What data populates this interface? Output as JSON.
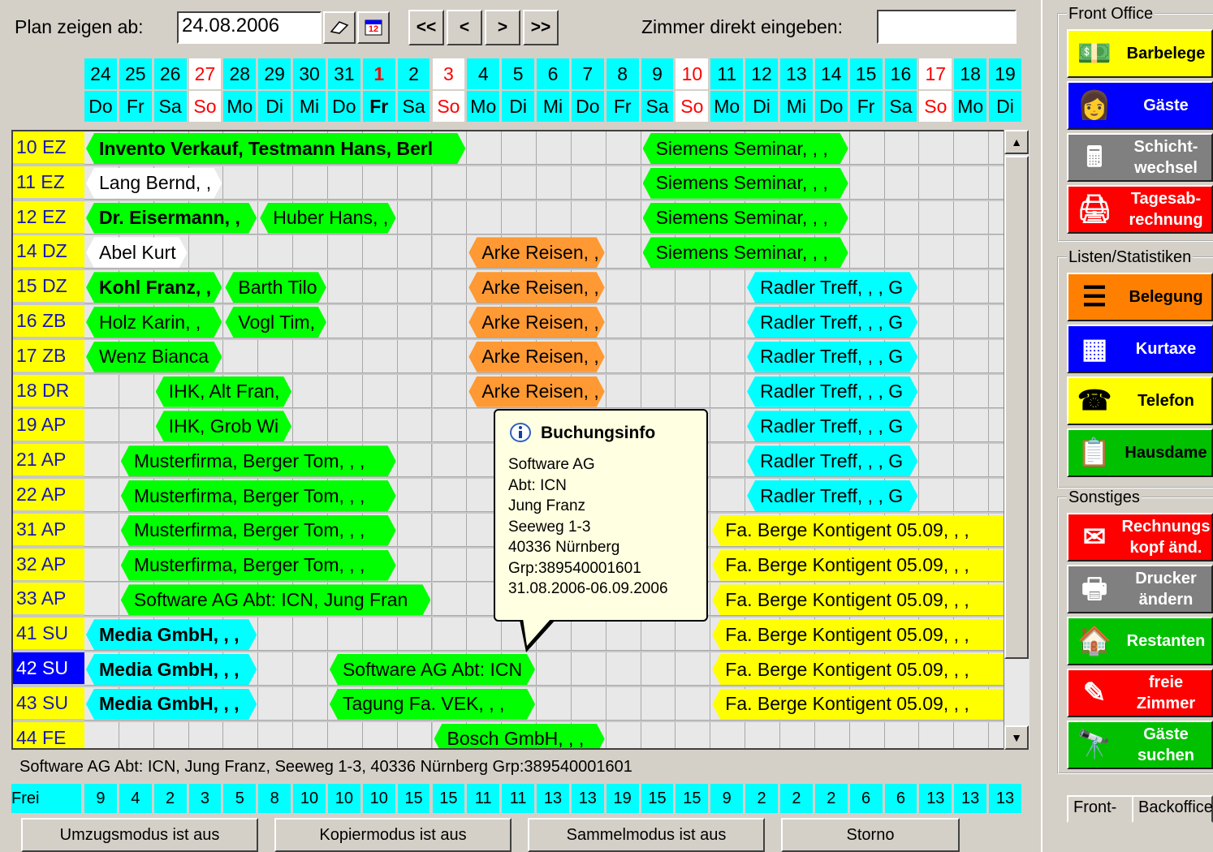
{
  "toolbar": {
    "plan_label": "Plan zeigen ab:",
    "date_value": "24.08.2006",
    "nav_first": "<<",
    "nav_prev": "<",
    "nav_next": ">",
    "nav_last": ">>",
    "room_label": "Zimmer direkt eingeben:",
    "room_value": "",
    "calendar_icon_text": "12"
  },
  "days": [
    {
      "n": "24",
      "w": "Do"
    },
    {
      "n": "25",
      "w": "Fr"
    },
    {
      "n": "26",
      "w": "Sa"
    },
    {
      "n": "27",
      "w": "So"
    },
    {
      "n": "28",
      "w": "Mo"
    },
    {
      "n": "29",
      "w": "Di"
    },
    {
      "n": "30",
      "w": "Mi"
    },
    {
      "n": "31",
      "w": "Do"
    },
    {
      "n": "1",
      "w": "Fr"
    },
    {
      "n": "2",
      "w": "Sa"
    },
    {
      "n": "3",
      "w": "So"
    },
    {
      "n": "4",
      "w": "Mo"
    },
    {
      "n": "5",
      "w": "Di"
    },
    {
      "n": "6",
      "w": "Mi"
    },
    {
      "n": "7",
      "w": "Do"
    },
    {
      "n": "8",
      "w": "Fr"
    },
    {
      "n": "9",
      "w": "Sa"
    },
    {
      "n": "10",
      "w": "So"
    },
    {
      "n": "11",
      "w": "Mo"
    },
    {
      "n": "12",
      "w": "Di"
    },
    {
      "n": "13",
      "w": "Mi"
    },
    {
      "n": "14",
      "w": "Do"
    },
    {
      "n": "15",
      "w": "Fr"
    },
    {
      "n": "16",
      "w": "Sa"
    },
    {
      "n": "17",
      "w": "So"
    },
    {
      "n": "18",
      "w": "Mo"
    },
    {
      "n": "19",
      "w": "Di"
    }
  ],
  "rooms": [
    "10 EZ",
    "11 EZ",
    "12 EZ",
    "14 DZ",
    "15 DZ",
    "16 ZB",
    "17 ZB",
    "18 DR",
    "19 AP",
    "21 AP",
    "22 AP",
    "31 AP",
    "32 AP",
    "33 AP",
    "41 SU",
    "42 SU",
    "43 SU",
    "44 FE"
  ],
  "bookings": [
    {
      "row": 0,
      "start": 0,
      "len": 11,
      "text": "Invento Verkauf, Testmann Hans, Berl",
      "color": "green",
      "bold": true
    },
    {
      "row": 0,
      "start": 16,
      "len": 6,
      "text": "Siemens Seminar, , ,",
      "color": "green"
    },
    {
      "row": 1,
      "start": 0,
      "len": 4,
      "text": "Lang Bernd, ,",
      "color": "white"
    },
    {
      "row": 1,
      "start": 16,
      "len": 6,
      "text": "Siemens Seminar, , ,",
      "color": "green"
    },
    {
      "row": 2,
      "start": 0,
      "len": 5,
      "text": "Dr. Eisermann, ,",
      "color": "green",
      "bold": true
    },
    {
      "row": 2,
      "start": 5,
      "len": 4,
      "text": "Huber Hans, ,",
      "color": "green"
    },
    {
      "row": 2,
      "start": 16,
      "len": 6,
      "text": "Siemens Seminar, , ,",
      "color": "green"
    },
    {
      "row": 3,
      "start": 0,
      "len": 3,
      "text": "Abel Kurt",
      "color": "white"
    },
    {
      "row": 3,
      "start": 11,
      "len": 4,
      "text": "Arke Reisen, ,",
      "color": "orange"
    },
    {
      "row": 3,
      "start": 16,
      "len": 6,
      "text": "Siemens Seminar, , ,",
      "color": "green"
    },
    {
      "row": 4,
      "start": 0,
      "len": 4,
      "text": "Kohl Franz, ,",
      "color": "green",
      "bold": true
    },
    {
      "row": 4,
      "start": 4,
      "len": 3,
      "text": "Barth Tilo",
      "color": "green"
    },
    {
      "row": 4,
      "start": 11,
      "len": 4,
      "text": "Arke Reisen, ,",
      "color": "orange"
    },
    {
      "row": 4,
      "start": 19,
      "len": 5,
      "text": "Radler Treff, , , G",
      "color": "cyan"
    },
    {
      "row": 5,
      "start": 0,
      "len": 4,
      "text": "Holz Karin, ,",
      "color": "green"
    },
    {
      "row": 5,
      "start": 4,
      "len": 3,
      "text": "Vogl Tim,",
      "color": "green"
    },
    {
      "row": 5,
      "start": 11,
      "len": 4,
      "text": "Arke Reisen, ,",
      "color": "orange"
    },
    {
      "row": 5,
      "start": 19,
      "len": 5,
      "text": "Radler Treff, , , G",
      "color": "cyan"
    },
    {
      "row": 6,
      "start": 0,
      "len": 4,
      "text": "Wenz Bianca",
      "color": "green"
    },
    {
      "row": 6,
      "start": 11,
      "len": 4,
      "text": "Arke Reisen, ,",
      "color": "orange"
    },
    {
      "row": 6,
      "start": 19,
      "len": 5,
      "text": "Radler Treff, , , G",
      "color": "cyan"
    },
    {
      "row": 7,
      "start": 2,
      "len": 4,
      "text": "IHK, Alt Fran,",
      "color": "green"
    },
    {
      "row": 7,
      "start": 11,
      "len": 4,
      "text": "Arke Reisen, ,",
      "color": "orange"
    },
    {
      "row": 7,
      "start": 19,
      "len": 5,
      "text": "Radler Treff, , , G",
      "color": "cyan"
    },
    {
      "row": 8,
      "start": 2,
      "len": 4,
      "text": "IHK, Grob Wi",
      "color": "green"
    },
    {
      "row": 8,
      "start": 19,
      "len": 5,
      "text": "Radler Treff, , , G",
      "color": "cyan"
    },
    {
      "row": 9,
      "start": 1,
      "len": 8,
      "text": "Musterfirma, Berger Tom, , ,",
      "color": "green"
    },
    {
      "row": 9,
      "start": 19,
      "len": 5,
      "text": "Radler Treff, , , G",
      "color": "cyan"
    },
    {
      "row": 10,
      "start": 1,
      "len": 8,
      "text": "Musterfirma, Berger Tom, , ,",
      "color": "green"
    },
    {
      "row": 10,
      "start": 19,
      "len": 5,
      "text": "Radler Treff, , , G",
      "color": "cyan"
    },
    {
      "row": 11,
      "start": 1,
      "len": 8,
      "text": "Musterfirma, Berger Tom, , ,",
      "color": "green"
    },
    {
      "row": 11,
      "start": 18,
      "len": 9,
      "text": "Fa. Berge Kontigent 05.09, , ,",
      "color": "yellow"
    },
    {
      "row": 12,
      "start": 1,
      "len": 8,
      "text": "Musterfirma, Berger Tom, , ,",
      "color": "green"
    },
    {
      "row": 12,
      "start": 18,
      "len": 9,
      "text": "Fa. Berge Kontigent 05.09, , ,",
      "color": "yellow"
    },
    {
      "row": 13,
      "start": 1,
      "len": 9,
      "text": "Software AG Abt: ICN, Jung Fran",
      "color": "green"
    },
    {
      "row": 13,
      "start": 18,
      "len": 9,
      "text": "Fa. Berge Kontigent 05.09, , ,",
      "color": "yellow"
    },
    {
      "row": 14,
      "start": 0,
      "len": 5,
      "text": "Media GmbH, , ,",
      "color": "cyan",
      "bold": true
    },
    {
      "row": 14,
      "start": 18,
      "len": 9,
      "text": "Fa. Berge Kontigent 05.09, , ,",
      "color": "yellow"
    },
    {
      "row": 15,
      "start": 0,
      "len": 5,
      "text": "Media GmbH, , ,",
      "color": "cyan",
      "bold": true
    },
    {
      "row": 15,
      "start": 7,
      "len": 6,
      "text": "Software AG Abt: ICN",
      "color": "green"
    },
    {
      "row": 15,
      "start": 18,
      "len": 9,
      "text": "Fa. Berge Kontigent 05.09, , ,",
      "color": "yellow"
    },
    {
      "row": 16,
      "start": 0,
      "len": 5,
      "text": "Media GmbH, , ,",
      "color": "cyan",
      "bold": true
    },
    {
      "row": 16,
      "start": 7,
      "len": 6,
      "text": "Tagung Fa. VEK, , ,",
      "color": "green"
    },
    {
      "row": 16,
      "start": 18,
      "len": 9,
      "text": "Fa. Berge Kontigent 05.09, , ,",
      "color": "yellow"
    },
    {
      "row": 17,
      "start": 10,
      "len": 5,
      "text": "Bosch GmbH, , ,",
      "color": "green"
    }
  ],
  "tooltip": {
    "title": "Buchungsinfo",
    "lines": [
      "Software AG",
      "Abt: ICN",
      "Jung Franz",
      "Seeweg 1-3",
      "40336 Nürnberg",
      "Grp:389540001601",
      "31.08.2006-06.09.2006"
    ]
  },
  "status_line": "Software AG Abt: ICN, Jung Franz, Seeweg 1-3, 40336 Nürnberg Grp:389540001601",
  "free": {
    "label": "Frei",
    "values": [
      "9",
      "4",
      "2",
      "3",
      "5",
      "8",
      "10",
      "10",
      "10",
      "15",
      "15",
      "11",
      "11",
      "13",
      "13",
      "19",
      "15",
      "15",
      "9",
      "2",
      "2",
      "2",
      "6",
      "6",
      "13",
      "13",
      "13"
    ]
  },
  "mode_buttons": [
    "Umzugsmodus ist aus",
    "Kopiermodus ist aus",
    "Sammelmodus ist aus",
    "Storno"
  ],
  "panel": {
    "groups": [
      "Front Office",
      "Listen/Statistiken",
      "Sonstiges"
    ],
    "buttons": [
      {
        "label": "Barbelege",
        "bg": "#ffff00",
        "fg": "#000",
        "icon": "💵"
      },
      {
        "label": "Gäste",
        "bg": "#0000ff",
        "fg": "#fff",
        "icon": "👩"
      },
      {
        "label": "Schicht-\nwechsel",
        "bg": "#808080",
        "fg": "#fff",
        "icon": "🖩"
      },
      {
        "label": "Tagesab-\nrechnung",
        "bg": "#ff0000",
        "fg": "#fff",
        "icon": "🖨"
      },
      {
        "label": "Belegung",
        "bg": "#ff8000",
        "fg": "#000",
        "icon": "☰"
      },
      {
        "label": "Kurtaxe",
        "bg": "#0000ff",
        "fg": "#fff",
        "icon": "▦"
      },
      {
        "label": "Telefon",
        "bg": "#ffff00",
        "fg": "#000",
        "icon": "☎"
      },
      {
        "label": "Hausdame",
        "bg": "#00c000",
        "fg": "#000",
        "icon": "📋"
      },
      {
        "label": "Rechnungs\nkopf änd.",
        "bg": "#ff0000",
        "fg": "#fff",
        "icon": "✉"
      },
      {
        "label": "Drucker\nändern",
        "bg": "#808080",
        "fg": "#fff",
        "icon": "🖶"
      },
      {
        "label": "Restanten",
        "bg": "#00c000",
        "fg": "#fff",
        "icon": "🏠"
      },
      {
        "label": "freie\nZimmer",
        "bg": "#ff0000",
        "fg": "#fff",
        "icon": "✎"
      },
      {
        "label": "Gäste\nsuchen",
        "bg": "#00c000",
        "fg": "#fff",
        "icon": "🔭"
      }
    ],
    "tabs": [
      "Front-",
      "Backoffice"
    ]
  }
}
